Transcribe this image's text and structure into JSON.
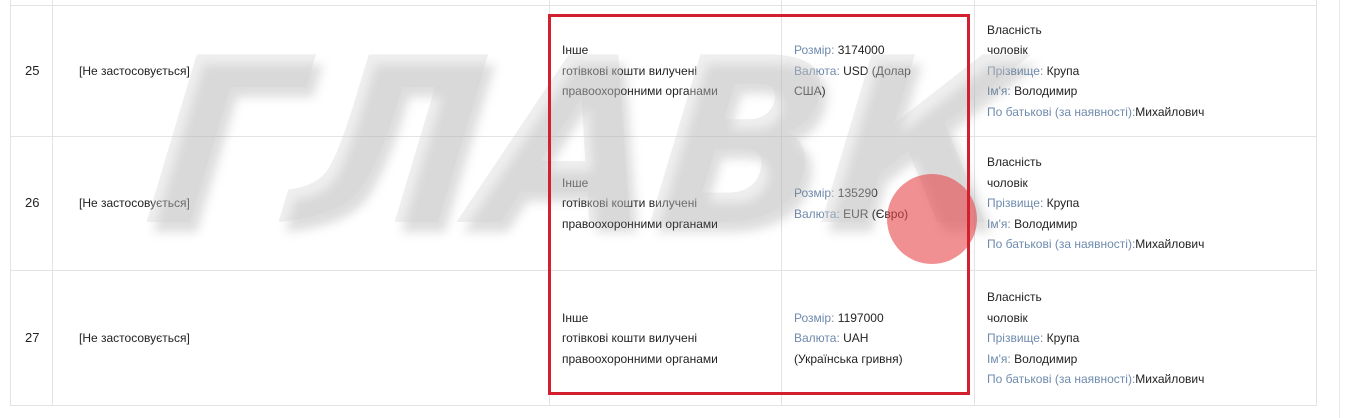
{
  "rows": [
    {
      "num": "25",
      "na": "[Не застосовується]",
      "type": [
        "Інше",
        "готівкові кошти вилучені",
        "правоохоронними органами"
      ],
      "size_label": "Розмір:",
      "size_value": "3174000",
      "currency_label": "Валюта:",
      "currency_lines": [
        "USD (Долар",
        "США)"
      ],
      "owner_rights": "Власність",
      "owner_relation": "чоловік",
      "surname_label": "Прізвище:",
      "surname": "Крупа",
      "name_label": "Ім'я:",
      "name": "Володимир",
      "patronymic_label": "По батькові (за наявності):",
      "patronymic": "Михайлович"
    },
    {
      "num": "26",
      "na": "[Не застосовується]",
      "type": [
        "Інше",
        "готівкові кошти вилучені",
        "правоохоронними органами"
      ],
      "size_label": "Розмір:",
      "size_value": "135290",
      "currency_label": "Валюта:",
      "currency_lines": [
        "EUR (Євро)",
        ""
      ],
      "owner_rights": "Власність",
      "owner_relation": "чоловік",
      "surname_label": "Прізвище:",
      "surname": "Крупа",
      "name_label": "Ім'я:",
      "name": "Володимир",
      "patronymic_label": "По батькові (за наявності):",
      "patronymic": "Михайлович"
    },
    {
      "num": "27",
      "na": "[Не застосовується]",
      "type": [
        "Інше",
        "готівкові кошти вилучені",
        "правоохоронними органами"
      ],
      "size_label": "Розмір:",
      "size_value": "1197000",
      "currency_label": "Валюта:",
      "currency_lines": [
        "UAH",
        "(Українська гривня)"
      ],
      "owner_rights": "Власність",
      "owner_relation": "чоловік",
      "surname_label": "Прізвище:",
      "surname": "Крупа",
      "name_label": "Ім'я:",
      "name": "Володимир",
      "patronymic_label": "По батькові (за наявності):",
      "patronymic": "Михайлович"
    }
  ],
  "watermark": {
    "text": "ГЛАВК",
    "dot_color": "#e8464b"
  },
  "highlight_color": "#d2202e"
}
